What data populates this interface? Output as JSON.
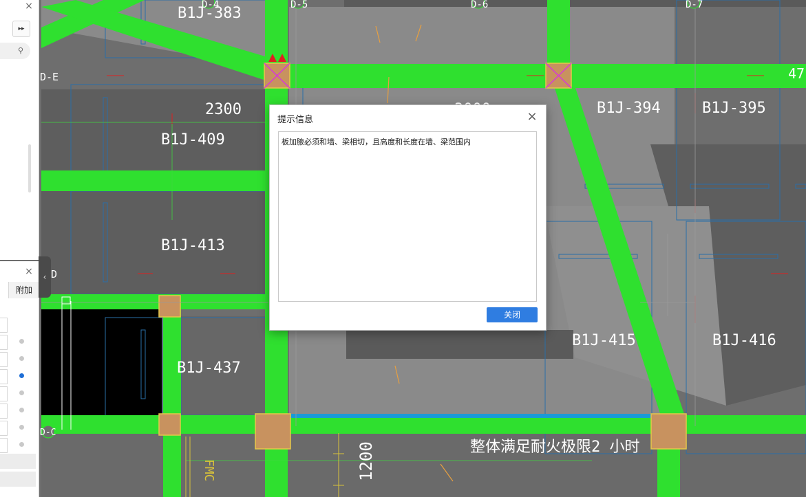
{
  "left_panel_top": {
    "close_glyph": "×",
    "more_glyph": "▸▸",
    "search_icon": "search-icon"
  },
  "left_panel_bottom": {
    "close_glyph": "×",
    "tab_label": "附加",
    "selected_row": 3,
    "row_count": 8
  },
  "collapse_glyph": "‹",
  "drawing": {
    "slab_labels": [
      "B1J-383",
      "B1J-409",
      "B1J-413",
      "B1J-437",
      "B1J-394",
      "B1J-395",
      "B1J-415",
      "B1J-416"
    ],
    "axis_labels": [
      "D-4",
      "D-5",
      "D-6",
      "D-7",
      "D-E",
      "D",
      "D-C"
    ],
    "dimensions": [
      "2300",
      "3000",
      "1200",
      "47"
    ],
    "fire_note": "整体满足耐火极限2 小时",
    "door_code": "FMC"
  },
  "dialog": {
    "title": "提示信息",
    "close_glyph": "×",
    "message": "板加腋必须和墙、梁相切，且高度和长度在墙、梁范围内",
    "button_label": "关闭"
  },
  "colors": {
    "beam": "#2fe02f",
    "column": "#c8925f",
    "slab_dark": "#606060",
    "slab_light": "#8a8a8a",
    "accent_button": "#2f7de1"
  }
}
